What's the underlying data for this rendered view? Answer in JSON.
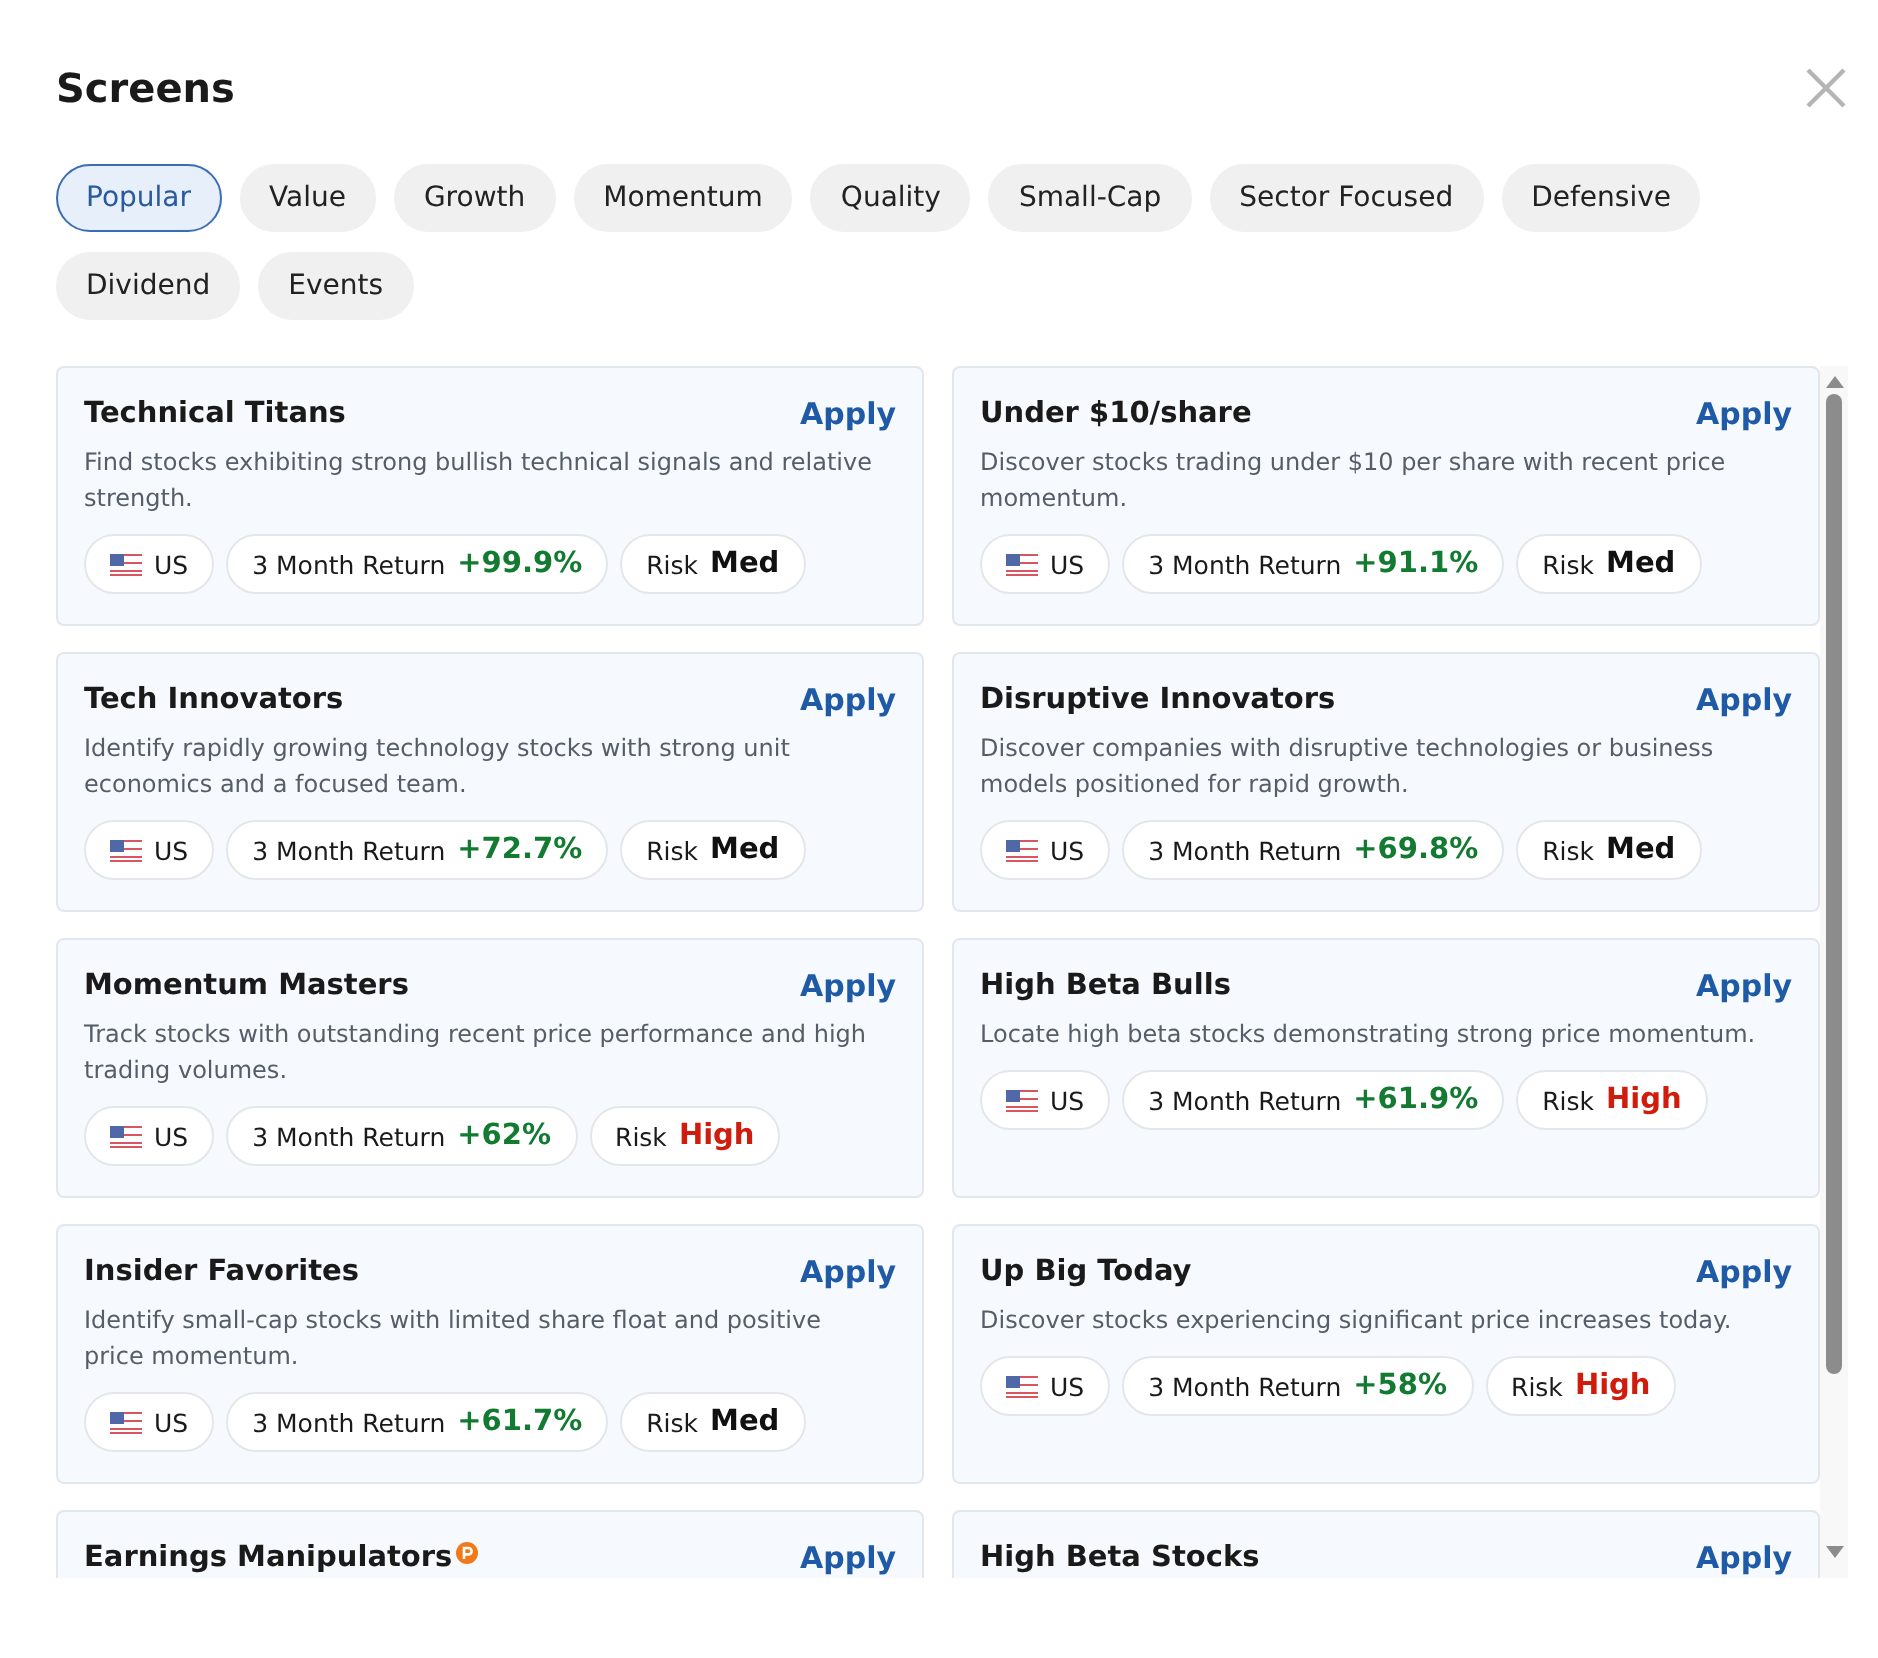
{
  "title": "Screens",
  "tabs": [
    {
      "label": "Popular",
      "selected": true
    },
    {
      "label": "Value",
      "selected": false
    },
    {
      "label": "Growth",
      "selected": false
    },
    {
      "label": "Momentum",
      "selected": false
    },
    {
      "label": "Quality",
      "selected": false
    },
    {
      "label": "Small-Cap",
      "selected": false
    },
    {
      "label": "Sector Focused",
      "selected": false
    },
    {
      "label": "Defensive",
      "selected": false
    },
    {
      "label": "Dividend",
      "selected": false
    },
    {
      "label": "Events",
      "selected": false
    }
  ],
  "screens": [
    {
      "name": "Technical Titans",
      "premium": false,
      "action": "Apply",
      "description": "Find stocks exhibiting strong bullish technical signals and relative strength.",
      "market": "US",
      "return_label": "3 Month Return",
      "return_value": "+99.9%",
      "risk_label": "Risk",
      "risk_value": "Med",
      "color": "#111111"
    },
    {
      "name": "Under $10/share",
      "premium": false,
      "action": "Apply",
      "description": "Discover stocks trading under $10 per share with recent price momentum.",
      "market": "US",
      "return_label": "3 Month Return",
      "return_value": "+91.1%",
      "risk_label": "Risk",
      "risk_value": "Med",
      "color": "#111111"
    },
    {
      "name": "Tech Innovators",
      "premium": false,
      "action": "Apply",
      "description": "Identify rapidly growing technology stocks with strong unit economics and a focused team.",
      "market": "US",
      "return_label": "3 Month Return",
      "return_value": "+72.7%",
      "risk_label": "Risk",
      "risk_value": "Med",
      "color": "#111111"
    },
    {
      "name": "Disruptive Innovators",
      "premium": false,
      "action": "Apply",
      "description": "Discover companies with disruptive technologies or business models positioned for rapid growth.",
      "market": "US",
      "return_label": "3 Month Return",
      "return_value": "+69.8%",
      "risk_label": "Risk",
      "risk_value": "Med",
      "color": "#111111"
    },
    {
      "name": "Momentum Masters",
      "premium": false,
      "action": "Apply",
      "description": "Track stocks with outstanding recent price performance and high trading volumes.",
      "market": "US",
      "return_label": "3 Month Return",
      "return_value": "+62%",
      "risk_label": "Risk",
      "risk_value": "High",
      "color": "#d01c0c"
    },
    {
      "name": "High Beta Bulls",
      "premium": false,
      "action": "Apply",
      "description": "Locate high beta stocks demonstrating strong price momentum.",
      "market": "US",
      "return_label": "3 Month Return",
      "return_value": "+61.9%",
      "risk_label": "Risk",
      "risk_value": "High",
      "color": "#d01c0c"
    },
    {
      "name": "Insider Favorites",
      "premium": false,
      "action": "Apply",
      "description": "Identify small-cap stocks with limited share float and positive price momentum.",
      "market": "US",
      "return_label": "3 Month Return",
      "return_value": "+61.7%",
      "risk_label": "Risk",
      "risk_value": "Med",
      "color": "#111111"
    },
    {
      "name": "Up Big Today",
      "premium": false,
      "action": "Apply",
      "description": "Discover stocks experiencing significant price increases today.",
      "market": "US",
      "return_label": "3 Month Return",
      "return_value": "+58%",
      "risk_label": "Risk",
      "risk_value": "High",
      "color": "#d01c0c"
    },
    {
      "name": "Earnings Manipulators",
      "premium": true,
      "action": "Apply"
    },
    {
      "name": "High Beta Stocks",
      "premium": false,
      "action": "Apply"
    }
  ]
}
